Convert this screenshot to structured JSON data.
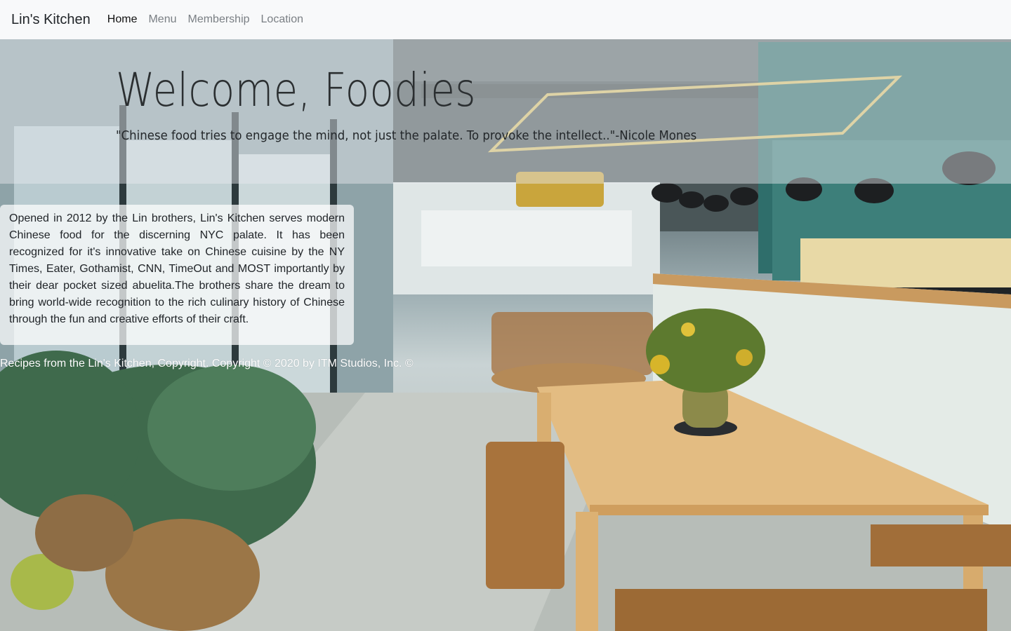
{
  "navbar": {
    "brand": "Lin's Kitchen",
    "links": [
      {
        "label": "Home",
        "active": true
      },
      {
        "label": "Menu",
        "active": false
      },
      {
        "label": "Membership",
        "active": false
      },
      {
        "label": "Location",
        "active": false
      }
    ]
  },
  "hero": {
    "title": "Welcome, Foodies",
    "quote": "\"Chinese food tries to engage the mind, not just the palate. To provoke the intellect..\"-Nicole Mones"
  },
  "about": {
    "text": "Opened in 2012 by the Lin brothers, Lin's Kitchen serves modern Chinese food for the discerning NYC palate. It has been recognized for it's innovative take on Chinese cuisine by the NY Times, Eater, Gothamist, CNN, TimeOut and MOST importantly by their dear pocket sized abuelita.The brothers share the dream to bring world-wide recognition to the rich culinary history of Chinese through the fun and creative efforts of their craft."
  },
  "footer": {
    "text": "Recipes from the Lin's Kitchen, Copyright. Copyright © 2020 by ITM Studios, Inc. ©"
  },
  "colors": {
    "navbar_bg": "#f8f9fa",
    "text_dark": "#212529",
    "nav_muted": "#7a7f84",
    "footer_text": "#ffffff"
  }
}
